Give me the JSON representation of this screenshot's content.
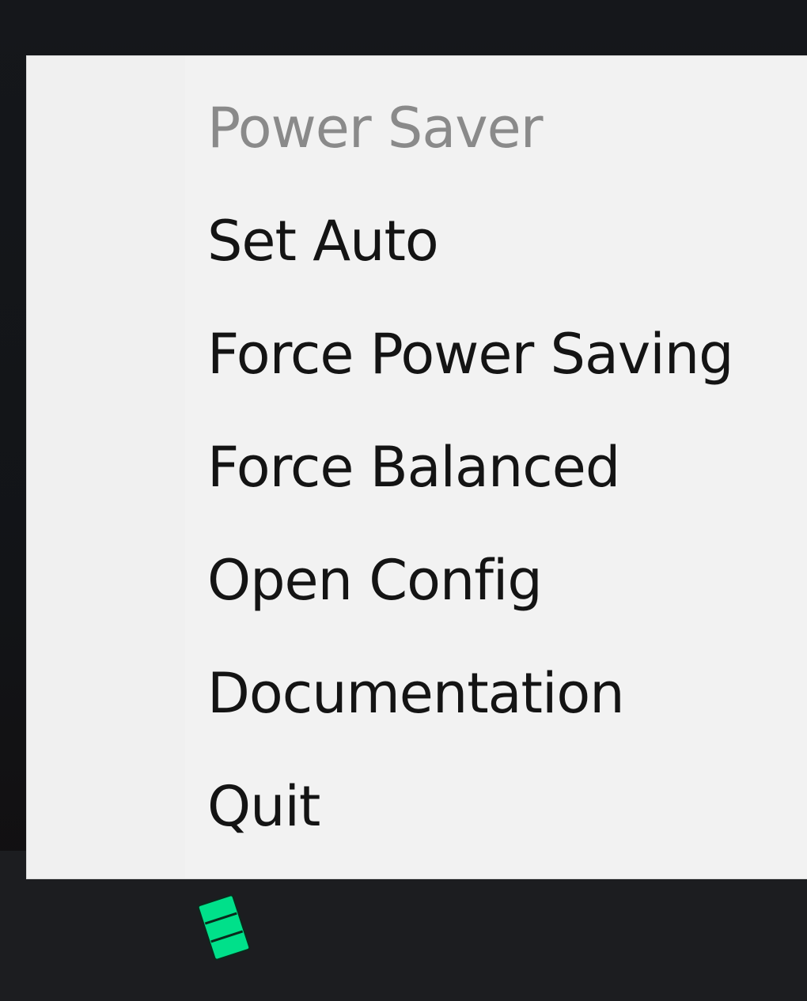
{
  "menu": {
    "header": "Power Saver",
    "items": [
      {
        "label": "Set Auto"
      },
      {
        "label": "Force Power Saving"
      },
      {
        "label": "Force Balanced"
      },
      {
        "label": "Open Config"
      },
      {
        "label": "Documentation"
      },
      {
        "label": "Quit"
      }
    ]
  },
  "tray": {
    "icon": "battery-icon",
    "icon_color": "#00e08a"
  }
}
